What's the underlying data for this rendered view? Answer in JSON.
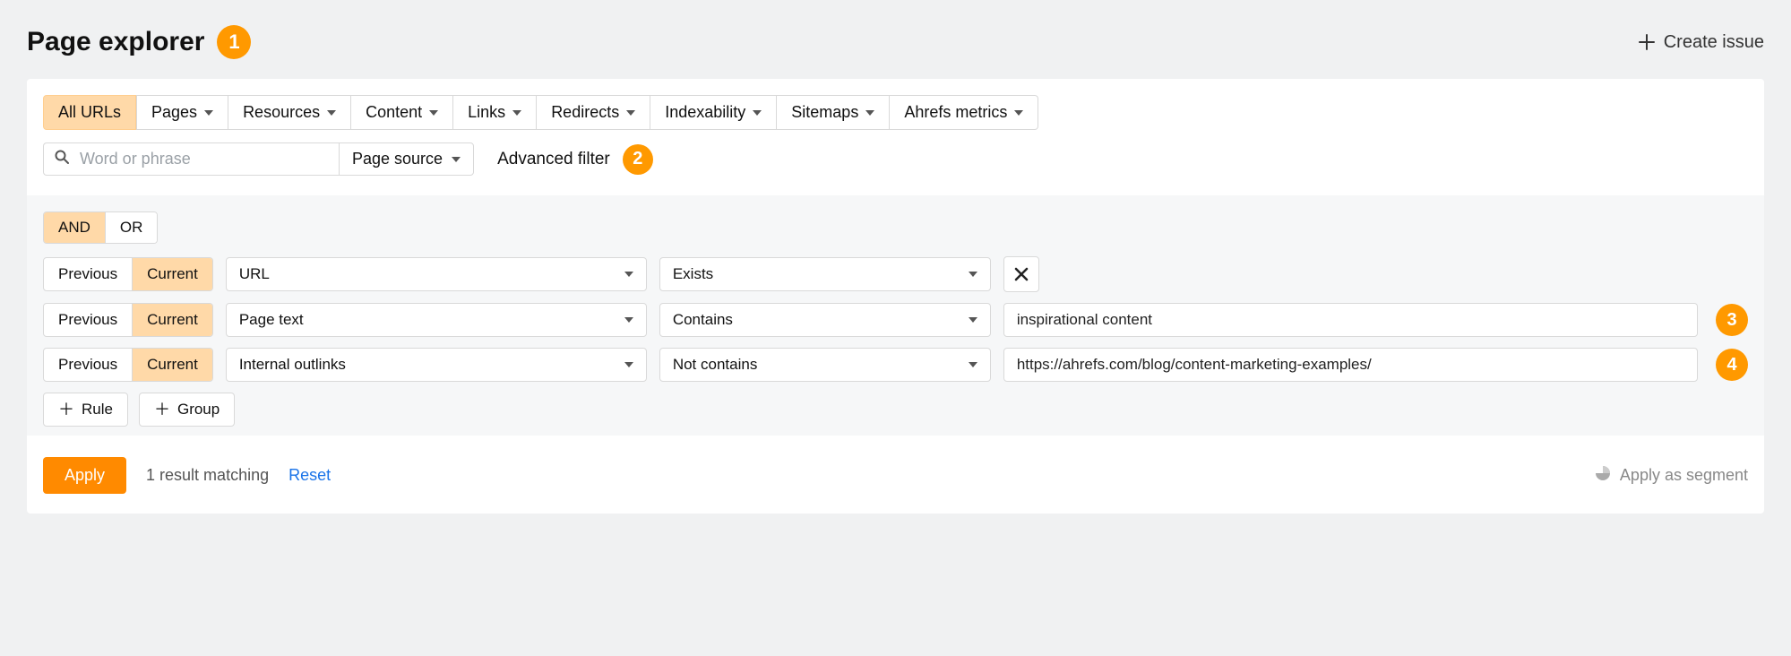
{
  "header": {
    "title": "Page explorer",
    "title_badge": "1",
    "create_issue_label": "Create issue"
  },
  "tabs": [
    {
      "label": "All URLs",
      "has_caret": false,
      "active": true
    },
    {
      "label": "Pages",
      "has_caret": true,
      "active": false
    },
    {
      "label": "Resources",
      "has_caret": true,
      "active": false
    },
    {
      "label": "Content",
      "has_caret": true,
      "active": false
    },
    {
      "label": "Links",
      "has_caret": true,
      "active": false
    },
    {
      "label": "Redirects",
      "has_caret": true,
      "active": false
    },
    {
      "label": "Indexability",
      "has_caret": true,
      "active": false
    },
    {
      "label": "Sitemaps",
      "has_caret": true,
      "active": false
    },
    {
      "label": "Ahrefs metrics",
      "has_caret": true,
      "active": false
    }
  ],
  "search": {
    "placeholder": "Word or phrase",
    "value": "",
    "source_label": "Page source",
    "advanced_label": "Advanced filter",
    "advanced_badge": "2"
  },
  "bool_ops": {
    "and": "AND",
    "or": "OR",
    "active": "AND"
  },
  "rules": [
    {
      "prev_label": "Previous",
      "cur_label": "Current",
      "field": "URL",
      "op": "Exists",
      "value": "",
      "has_value_input": false,
      "has_delete": true,
      "side_badge": ""
    },
    {
      "prev_label": "Previous",
      "cur_label": "Current",
      "field": "Page text",
      "op": "Contains",
      "value": "inspirational content",
      "has_value_input": true,
      "has_delete": false,
      "side_badge": "3"
    },
    {
      "prev_label": "Previous",
      "cur_label": "Current",
      "field": "Internal outlinks",
      "op": "Not contains",
      "value": "https://ahrefs.com/blog/content-marketing-examples/",
      "has_value_input": true,
      "has_delete": false,
      "side_badge": "4"
    }
  ],
  "add": {
    "rule_label": "Rule",
    "group_label": "Group"
  },
  "footer": {
    "apply_label": "Apply",
    "result_text": "1 result matching",
    "reset_label": "Reset",
    "apply_segment_label": "Apply as segment"
  }
}
